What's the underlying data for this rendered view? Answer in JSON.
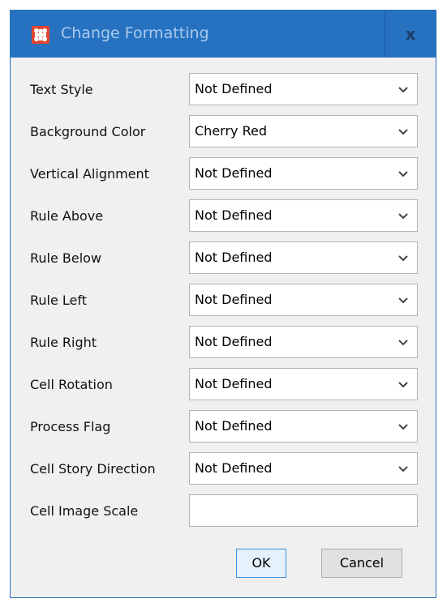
{
  "window": {
    "title": "Change Formatting",
    "close_label": "x",
    "accent_color": "#2672c0",
    "icon_color": "#e2462f"
  },
  "fields": [
    {
      "label": "Text Style",
      "value": "Not Defined"
    },
    {
      "label": "Background Color",
      "value": "Cherry Red"
    },
    {
      "label": "Vertical Alignment",
      "value": "Not Defined"
    },
    {
      "label": "Rule Above",
      "value": "Not Defined"
    },
    {
      "label": "Rule Below",
      "value": "Not Defined"
    },
    {
      "label": "Rule Left",
      "value": "Not Defined"
    },
    {
      "label": "Rule Right",
      "value": "Not Defined"
    },
    {
      "label": "Cell Rotation",
      "value": "Not Defined"
    },
    {
      "label": "Process Flag",
      "value": "Not Defined"
    },
    {
      "label": "Cell Story Direction",
      "value": "Not Defined"
    }
  ],
  "image_scale": {
    "label": "Cell Image Scale",
    "value": ""
  },
  "buttons": {
    "ok": "OK",
    "cancel": "Cancel"
  },
  "icons": {
    "app": "app-logo-icon",
    "dropdown": "chevron-down-icon"
  }
}
